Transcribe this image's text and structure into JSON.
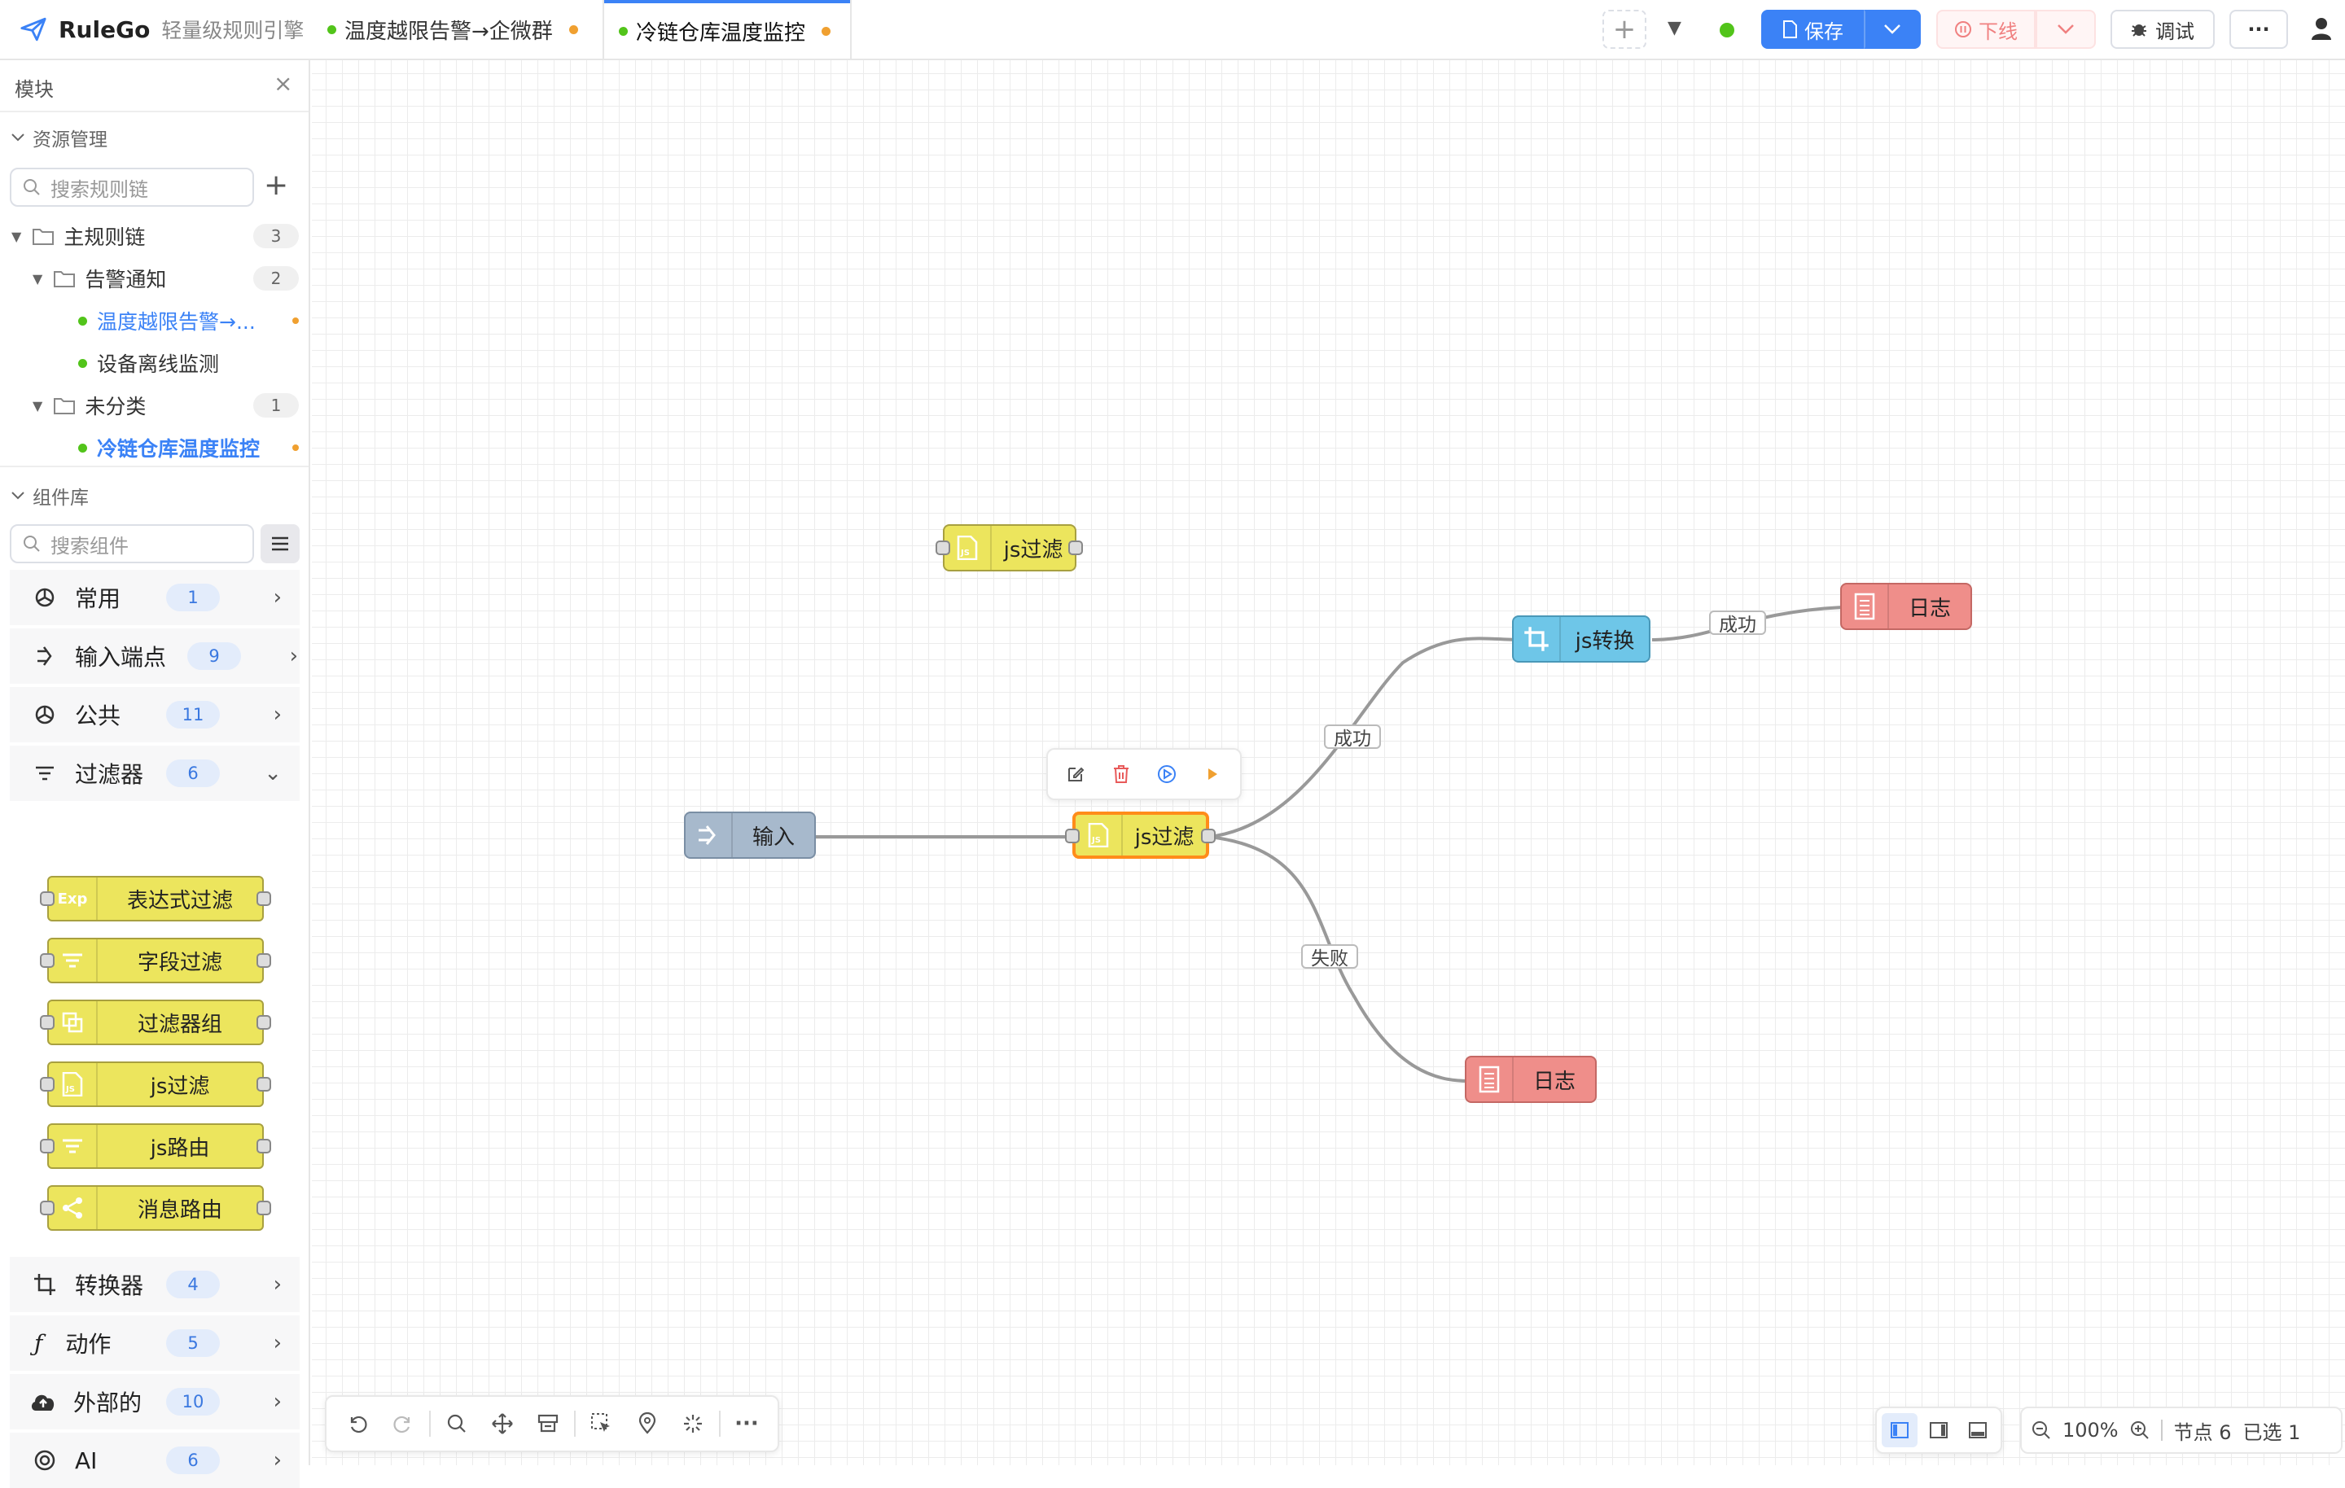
{
  "app": {
    "name": "RuleGo",
    "subtitle": "轻量级规则引擎"
  },
  "tabs": [
    {
      "label": "温度越限告警→企微群",
      "status_color": "#52c41a",
      "modified_color": "#f0a030",
      "active": false
    },
    {
      "label": "冷链仓库温度监控",
      "status_color": "#52c41a",
      "modified_color": "#f0a030",
      "active": true
    }
  ],
  "header": {
    "add_tab": "+",
    "save_label": "保存",
    "offline_label": "下线",
    "debug_label": "调试",
    "more_label": "···",
    "status_color": "#52c41a",
    "accent": "#3b82f6"
  },
  "sidebar": {
    "title": "模块",
    "resource_section": "资源管理",
    "search_chain_placeholder": "搜索规则链",
    "tree": [
      {
        "label": "主规则链",
        "count": "3"
      },
      {
        "label": "告警通知",
        "count": "2"
      },
      {
        "label": "温度越限告警→...",
        "count": ""
      },
      {
        "label": "设备离线监测",
        "count": ""
      },
      {
        "label": "未分类",
        "count": "1"
      },
      {
        "label": "冷链仓库温度监控",
        "count": ""
      }
    ],
    "component_section": "组件库",
    "search_component_placeholder": "搜索组件",
    "categories": [
      {
        "label": "常用",
        "count": "1"
      },
      {
        "label": "输入端点",
        "count": "9"
      },
      {
        "label": "公共",
        "count": "11"
      },
      {
        "label": "过滤器",
        "count": "6"
      },
      {
        "label": "转换器",
        "count": "4"
      },
      {
        "label": "动作",
        "count": "5"
      },
      {
        "label": "外部的",
        "count": "10"
      },
      {
        "label": "AI",
        "count": "6"
      }
    ],
    "filter_components": [
      {
        "label": "表达式过滤",
        "icon": "Exp"
      },
      {
        "label": "字段过滤",
        "icon": "filter-icon"
      },
      {
        "label": "过滤器组",
        "icon": "group-icon"
      },
      {
        "label": "js过滤",
        "icon": "js-icon"
      },
      {
        "label": "js路由",
        "icon": "filter-icon"
      },
      {
        "label": "消息路由",
        "icon": "share-icon"
      }
    ]
  },
  "canvas": {
    "nodes": [
      {
        "label": "js过滤",
        "type": "filter"
      },
      {
        "label": "输入",
        "type": "input"
      },
      {
        "label": "js过滤",
        "type": "filter"
      },
      {
        "label": "js转换",
        "type": "transform"
      },
      {
        "label": "日志",
        "type": "log"
      },
      {
        "label": "日志",
        "type": "log"
      }
    ],
    "edge_labels": [
      "成功",
      "成功",
      "失败"
    ],
    "colors": {
      "filter": "#ece55d",
      "input": "#a7b9cc",
      "transform": "#6ec6e8",
      "log": "#ef8e8a",
      "selected": "#ff8c1a"
    }
  },
  "bottom_bar": {
    "zoom": "100%",
    "node_count_label": "节点 6",
    "selected_label": "已选 1"
  }
}
